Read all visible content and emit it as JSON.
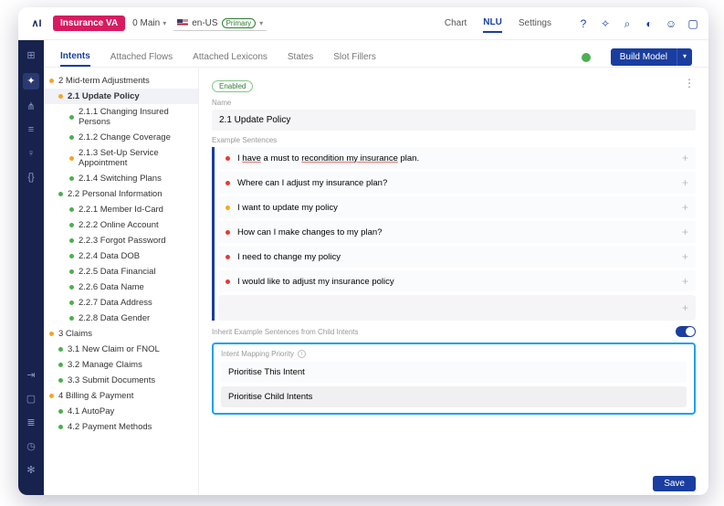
{
  "logo": "∧I",
  "project": "Insurance VA",
  "branch": "0 Main",
  "locale": {
    "code": "en-US",
    "badge": "Primary"
  },
  "topnav": {
    "chart": "Chart",
    "nlu": "NLU",
    "settings": "Settings"
  },
  "subtabs": {
    "intents": "Intents",
    "attached_flows": "Attached Flows",
    "attached_lexicons": "Attached Lexicons",
    "states": "States",
    "slot_fillers": "Slot Fillers"
  },
  "build_button": "Build Model",
  "tree": [
    {
      "label": "2 Mid-term Adjustments",
      "dot": "yellow",
      "indent": 0
    },
    {
      "label": "2.1 Update Policy",
      "dot": "yellow",
      "indent": 1,
      "selected": true
    },
    {
      "label": "2.1.1 Changing Insured Persons",
      "dot": "green",
      "indent": 2
    },
    {
      "label": "2.1.2 Change Coverage",
      "dot": "green",
      "indent": 2
    },
    {
      "label": "2.1.3 Set-Up Service Appointment",
      "dot": "yellow",
      "indent": 2
    },
    {
      "label": "2.1.4 Switching Plans",
      "dot": "green",
      "indent": 2
    },
    {
      "label": "2.2 Personal Information",
      "dot": "green",
      "indent": 1
    },
    {
      "label": "2.2.1 Member Id-Card",
      "dot": "green",
      "indent": 2
    },
    {
      "label": "2.2.2 Online Account",
      "dot": "green",
      "indent": 2
    },
    {
      "label": "2.2.3 Forgot Password",
      "dot": "green",
      "indent": 2
    },
    {
      "label": "2.2.4 Data DOB",
      "dot": "green",
      "indent": 2
    },
    {
      "label": "2.2.5 Data Financial",
      "dot": "green",
      "indent": 2
    },
    {
      "label": "2.2.6 Data Name",
      "dot": "green",
      "indent": 2
    },
    {
      "label": "2.2.7 Data Address",
      "dot": "green",
      "indent": 2
    },
    {
      "label": "2.2.8 Data Gender",
      "dot": "green",
      "indent": 2
    },
    {
      "label": "3 Claims",
      "dot": "yellow",
      "indent": 0
    },
    {
      "label": "3.1 New Claim or FNOL",
      "dot": "green",
      "indent": 1
    },
    {
      "label": "3.2 Manage Claims",
      "dot": "green",
      "indent": 1
    },
    {
      "label": "3.3 Submit Documents",
      "dot": "green",
      "indent": 1
    },
    {
      "label": "4 Billing & Payment",
      "dot": "yellow",
      "indent": 0
    },
    {
      "label": "4.1 AutoPay",
      "dot": "green",
      "indent": 1
    },
    {
      "label": "4.2 Payment Methods",
      "dot": "green",
      "indent": 1
    }
  ],
  "editor": {
    "enabled_chip": "Enabled",
    "name_label": "Name",
    "name_value": "2.1 Update Policy",
    "example_label": "Example Sentences",
    "sentences": [
      {
        "dot": "red",
        "html": "I <span class='underline'>have</span> a must to <span class='underline'>recondition my insurance</span> plan."
      },
      {
        "dot": "red",
        "text": "Where can I adjust my insurance plan?"
      },
      {
        "dot": "yellow",
        "text": "I want to update my policy"
      },
      {
        "dot": "red",
        "text": "How can I make changes to my plan?"
      },
      {
        "dot": "red",
        "text": "I need to change my policy"
      },
      {
        "dot": "red",
        "text": "I would like to adjust my insurance policy"
      }
    ],
    "inherit_label": "Inherit Example Sentences from Child Intents",
    "priority_label": "Intent Mapping Priority",
    "priority_options": [
      "Prioritise This Intent",
      "Prioritise Child Intents"
    ],
    "save": "Save"
  }
}
